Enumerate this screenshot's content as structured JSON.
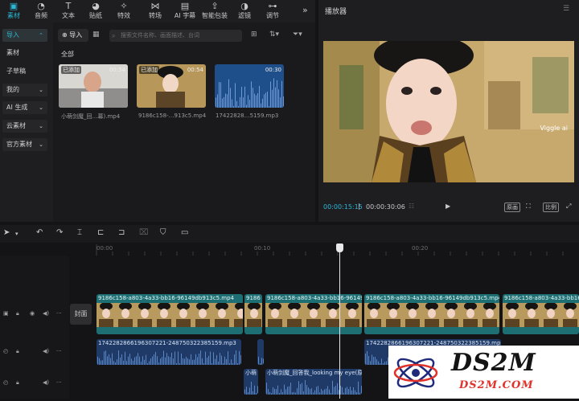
{
  "toolbar": {
    "items": [
      {
        "label": "素材",
        "icon": "media-icon",
        "active": true
      },
      {
        "label": "音频",
        "icon": "audio-icon"
      },
      {
        "label": "文本",
        "icon": "text-icon"
      },
      {
        "label": "贴纸",
        "icon": "sticker-icon"
      },
      {
        "label": "特效",
        "icon": "effects-icon"
      },
      {
        "label": "转场",
        "icon": "transition-icon"
      },
      {
        "label": "AI 字幕",
        "icon": "ai-caption-icon"
      },
      {
        "label": "智能包装",
        "icon": "smart-package-icon"
      },
      {
        "label": "滤镜",
        "icon": "filter-icon"
      },
      {
        "label": "调节",
        "icon": "adjust-icon"
      }
    ],
    "more_glyph": "»"
  },
  "sidebar": {
    "items": [
      {
        "label": "导入",
        "active": true,
        "chevron": "⌃"
      },
      {
        "label": "素材"
      },
      {
        "label": "子草稿"
      },
      {
        "label": "我的",
        "chevron": "⌄"
      },
      {
        "label": "AI 生成",
        "chevron": "⌄"
      },
      {
        "label": "云素材",
        "chevron": "⌄"
      },
      {
        "label": "官方素材",
        "chevron": "⌄"
      }
    ]
  },
  "media": {
    "import_label": "导入",
    "search_placeholder": "搜索文件名称、画面描述、台词",
    "section_label": "全部",
    "cards": [
      {
        "badge": "已添加",
        "duration": "00:54",
        "name": "小萌剑魔_回…幕).mp4"
      },
      {
        "badge": "已添加",
        "duration": "00:54",
        "name": "9186c158-…913c5.mp4"
      },
      {
        "badge": "",
        "duration": "00:30",
        "name": "17422828…5159.mp3"
      }
    ]
  },
  "player": {
    "title": "播放器",
    "watermark": "Viggle ai",
    "time_current": "00:00:15:15",
    "time_total": "00:00:30:06",
    "btn_quality": "原画",
    "btn_ratio": "比例"
  },
  "timeline": {
    "ruler_labels": [
      "00:00",
      "00:10",
      "00:20"
    ],
    "cover_label": "封面",
    "video_clip_name": "9186c158-a803-4a33-bb16-96149db913c5.mp4",
    "video_clip_short": "9186",
    "audio_clip_name_1": "17422828661963072​21-248750322385159.mp3",
    "audio_clip_name_2": "17422828661963072​21-248750322385159.mp3",
    "audio_clip_3": "小萌剑魔_回答我_looking my eye(原版)",
    "audio_clip_3_short": "小萌"
  },
  "colors": {
    "accent": "#2bb7d6",
    "video_clip": "#1e6f74",
    "audio_clip": "#1f3a66"
  },
  "logo": {
    "text_top": "DS2M",
    "text_bottom": "DS2M.COM"
  }
}
